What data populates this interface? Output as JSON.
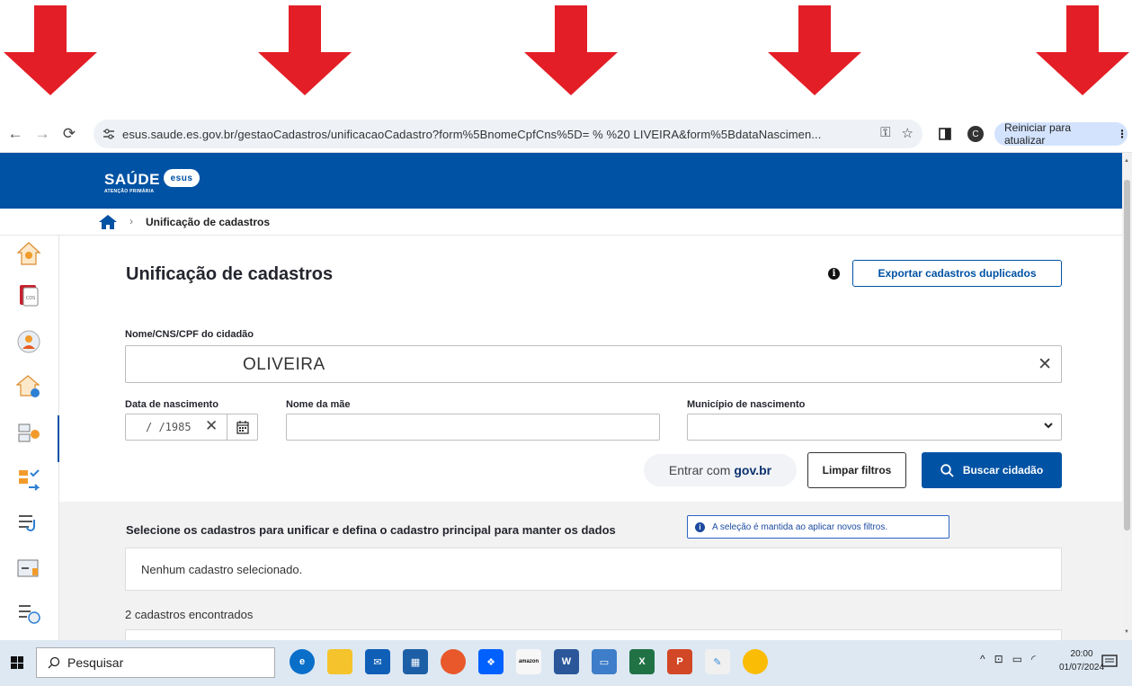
{
  "browser": {
    "url": "esus.saude.es.gov.br/gestaoCadastros/unificacaoCadastro?form%5BnomeCpfCns%5D=        %      %20  LIVEIRA&form%5BdataNascimen...",
    "restart_label": "Reiniciar para atualizar",
    "profile_initial": "C"
  },
  "app": {
    "logo_text": "SAÚDE",
    "logo_sub": "ATENÇÃO PRIMÁRIA",
    "logo_badge": "esus"
  },
  "breadcrumb": {
    "current": "Unificação de cadastros"
  },
  "page": {
    "title": "Unificação de cadastros",
    "export_button": "Exportar cadastros duplicados"
  },
  "filters": {
    "name_label": "Nome/CNS/CPF do cidadão",
    "name_value": "OLIVEIRA",
    "birth_label": "Data de nascimento",
    "birth_value": "/  /1985",
    "mother_label": "Nome da mãe",
    "mother_value": "",
    "municipality_label": "Município de nascimento",
    "municipality_value": ""
  },
  "actions": {
    "govbr_prefix": "Entrar com",
    "govbr_brand": "gov.br",
    "clear_button": "Limpar filtros",
    "search_button": "Buscar cidadão"
  },
  "selection": {
    "title": "Selecione os cadastros para unificar e defina o cadastro principal para manter os dados",
    "note": "A seleção é mantida ao aplicar novos filtros.",
    "empty_text": "Nenhum cadastro selecionado.",
    "found_text": "2 cadastros encontrados"
  },
  "taskbar": {
    "search_placeholder": "Pesquisar",
    "time": "20:00",
    "date": "01/07/2024"
  },
  "colors": {
    "primary": "#0052a4",
    "arrow_red": "#e41e26",
    "taskbar": "#dde8f3"
  }
}
